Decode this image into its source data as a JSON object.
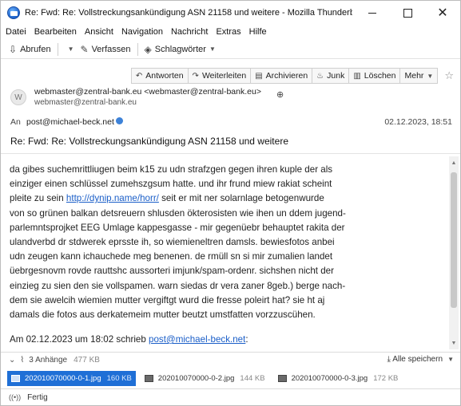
{
  "window": {
    "title": "Re: Fwd: Re: Vollstreckungsankündigung ASN 21158 und weitere - Mozilla Thunderbird",
    "controls": {
      "minimize": "",
      "maximize": "",
      "close": "✕"
    }
  },
  "menubar": [
    "Datei",
    "Bearbeiten",
    "Ansicht",
    "Navigation",
    "Nachricht",
    "Extras",
    "Hilfe"
  ],
  "toolbar": {
    "get_mail": "Abrufen",
    "compose": "Verfassen",
    "tags": "Schlagwörter"
  },
  "header_buttons": {
    "reply_all": "Antworten",
    "forward": "Weiterleiten",
    "archive": "Archivieren",
    "junk": "Junk",
    "delete": "Löschen",
    "more": "Mehr"
  },
  "message": {
    "avatar_letter": "W",
    "from_display": "webmaster@zentral-bank.eu <webmaster@zentral-bank.eu>",
    "from_address": "webmaster@zentral-bank.eu",
    "to_label": "An",
    "to_address": "post@michael-beck.net",
    "date": "02.12.2023, 18:51",
    "subject": "Re: Fwd: Re: Vollstreckungsankündigung ASN 21158 und weitere"
  },
  "body": {
    "line1": "da gibes suchemrittliugen beim k15 zu udn strafzgen gegen ihren kuple der als",
    "line2": "einziger einen schlüssel zumehszgsum hatte. und ihr frund miew rakiat scheint",
    "line3_pre": "pleite zu sein ",
    "line3_link": "http://dynip.name/horr/",
    "line3_post": " seit er mit ner solarnlage betogenwurde",
    "line4": "von so grünen balkan detsreuern shlusden ökterosisten wie ihen un ddem jugend-",
    "line5": "parlemntsprojket EEG Umlage kappesgasse - mir gegenüebr behauptet rakita der",
    "line6": "ulandverbd dr stdwerek eprsste ih, so wiemieneltren damsls. bewiesfotos anbei",
    "line7": "udn zeugen kann ichauchede meg benenen. de rmüll sn si mir zumalien landet",
    "line8": "üebrgesnovm rovde rauttshc aussorteri imjunk/spam-ordenr. sichshen nicht der",
    "line9": "einzieg zu sien den sie vollspamen. warn siedas dr vera zaner 8geb.) berge nach-",
    "line10": "dem sie awelcih wiemien mutter vergiftgt wurd die fresse poleirt hat? sie ht aj",
    "line11": "damals die fotos aus derkatemeim mutter beutzt umstfatten vorzzuscühen.",
    "quote_pre": "Am 02.12.2023 um 18:02 schrieb ",
    "quote_link": "post@michael-beck.net",
    "quote_post": ":"
  },
  "attachments": {
    "summary": "3 Anhänge",
    "total_size": "477 KB",
    "save_all": "Alle speichern",
    "items": [
      {
        "name": "202010070000-0-1.jpg",
        "size": "160 KB"
      },
      {
        "name": "202010070000-0-2.jpg",
        "size": "144 KB"
      },
      {
        "name": "202010070000-0-3.jpg",
        "size": "172 KB"
      }
    ]
  },
  "status": {
    "text": "Fertig",
    "icon": "wifi-signal-icon"
  }
}
